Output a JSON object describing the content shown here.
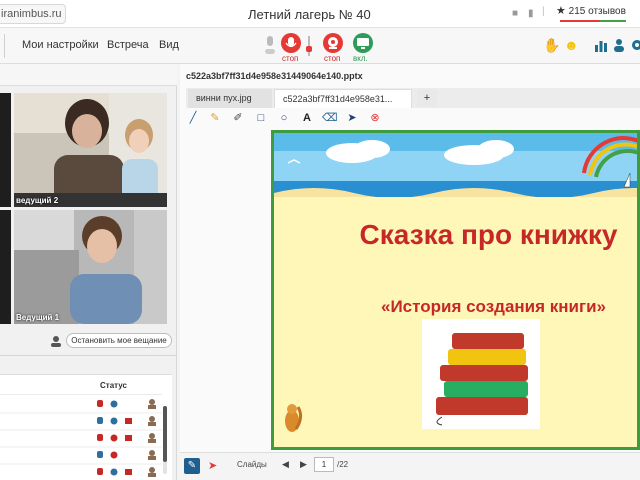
{
  "browser": {
    "url_fragment": "iranimbus.ru"
  },
  "meeting": {
    "title": "Летний лагерь № 40"
  },
  "reviews": {
    "label": "215 отзывов"
  },
  "menu": {
    "my_settings": "Мои настройки",
    "meeting": "Встреча",
    "view": "Вид"
  },
  "controls": {
    "mic_stop": "стоп",
    "cam_stop": "стоп",
    "screen_on": "вкл."
  },
  "videos": [
    {
      "label": "ведущий 2"
    },
    {
      "label": "Ведущий 1"
    }
  ],
  "stop_broadcast": "Остановить мое вещание",
  "participants": {
    "status_header": "Статус"
  },
  "document": {
    "file_title": "c522a3bf7ff31d4e958e31449064e140.pptx",
    "tabs": [
      {
        "label": "винни пух.jpg"
      },
      {
        "label": "c522a3bf7ff31d4e958e31..."
      }
    ],
    "add_tab": "+"
  },
  "slide": {
    "title": "Сказка про книжку",
    "subtitle": "«История создания  книги»"
  },
  "pager": {
    "slides_label": "Слайды",
    "current_page": "1",
    "total": "/22"
  },
  "colors": {
    "accent_red": "#e53935",
    "green": "#43a047",
    "slide_border": "#3e9b3e",
    "slide_text": "#c62828"
  }
}
